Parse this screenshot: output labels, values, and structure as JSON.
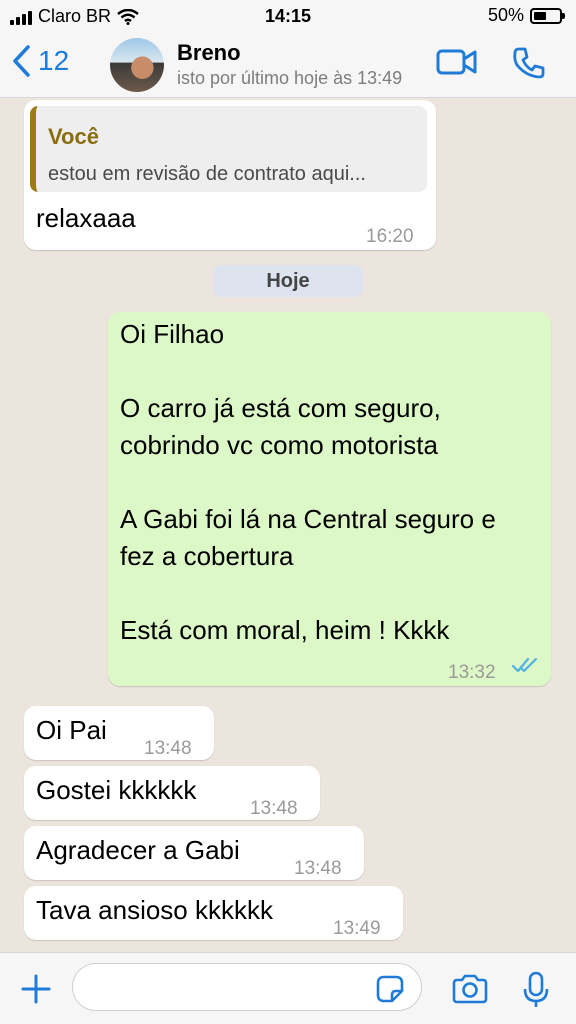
{
  "status_bar": {
    "carrier": "Claro BR",
    "time": "14:15",
    "battery_percent": "50%",
    "battery_level": 0.5
  },
  "header": {
    "back_count": "12",
    "contact_name": "Breno",
    "last_seen": "isto por último hoje às 13:49",
    "accent_color": "#1f7bd8"
  },
  "messages": {
    "m1": {
      "quote_author": "Você",
      "quote_text": "estou em revisão de contrato aqui...",
      "text": "relaxaaa",
      "time": "16:20"
    },
    "date_separator": "Hoje",
    "m2": {
      "lines": [
        "Oi Filhao",
        "O carro já está com seguro,",
        "cobrindo vc como motorista",
        "A Gabi foi lá na Central seguro e",
        "fez a cobertura",
        "Está com moral, heim ! Kkkk"
      ],
      "time": "13:32",
      "status": "read",
      "status_icon": "double-check-icon"
    },
    "m3": {
      "text": "Oi Pai",
      "time": "13:48"
    },
    "m4": {
      "text": "Gostei kkkkkk",
      "time": "13:48"
    },
    "m5": {
      "text": "Agradecer a Gabi",
      "time": "13:48"
    },
    "m6": {
      "text": "Tava ansioso kkkkkk",
      "time": "13:49"
    }
  },
  "composer": {
    "input_value": "",
    "icons": [
      "plus-icon",
      "sticker-icon",
      "camera-icon",
      "microphone-icon"
    ]
  },
  "colors": {
    "chat_background": "#ece5dd",
    "incoming_bubble": "#ffffff",
    "outgoing_bubble": "#dcf8c6",
    "read_receipt": "#4fb3e8"
  }
}
